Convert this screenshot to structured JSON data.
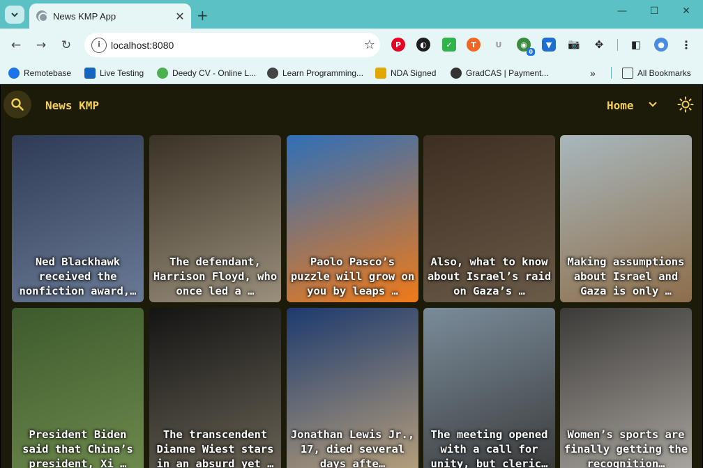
{
  "browser": {
    "tab": {
      "title": "News KMP App"
    },
    "new_tab": "+",
    "address": {
      "url": "localhost:8080"
    },
    "bookmarks": [
      {
        "label": "Remotebase",
        "icon": "remotebase-icon",
        "color": "#1a73e8"
      },
      {
        "label": "Live Testing",
        "icon": "live-testing-icon",
        "color": "#1565c0"
      },
      {
        "label": "Deedy CV - Online L...",
        "icon": "deedy-cv-icon",
        "color": "#4caf50"
      },
      {
        "label": "Learn Programming...",
        "icon": "learn-programming-icon",
        "color": "#444444"
      },
      {
        "label": "NDA Signed",
        "icon": "download-icon",
        "color": "#e0a800"
      },
      {
        "label": "GradCAS | Payment...",
        "icon": "globe-icon",
        "color": "#333333"
      }
    ],
    "all_bookmarks": "All Bookmarks",
    "extensions_badge": "0"
  },
  "app": {
    "title": "News KMP",
    "nav_menu": "Home",
    "accent_color": "#f0cf5a",
    "background_color": "#1c1a08"
  },
  "articles": [
    {
      "title": "Ned Blackhawk received the nonfiction award,…",
      "tone": [
        "#2f3b55",
        "#6a7a96"
      ]
    },
    {
      "title": "The defendant, Harrison Floyd, who once led a …",
      "tone": [
        "#3a3226",
        "#9a8f7c"
      ]
    },
    {
      "title": "Paolo Pasco’s puzzle will grow on you by leaps …",
      "tone": [
        "#2f6fb8",
        "#f07a18"
      ]
    },
    {
      "title": "Also, what to know about Israel’s raid on Gaza’s …",
      "tone": [
        "#3d2e22",
        "#6a5a48"
      ]
    },
    {
      "title": "Making assumptions about Israel and Gaza is only …",
      "tone": [
        "#a8b7bd",
        "#8e6e4a"
      ]
    },
    {
      "title": "President Biden said that China’s president, Xi …",
      "tone": [
        "#3c5a2c",
        "#6f8a4e"
      ]
    },
    {
      "title": "The transcendent Dianne Wiest stars in an absurd yet …",
      "tone": [
        "#141414",
        "#6a6456"
      ]
    },
    {
      "title": "Jonathan Lewis Jr., 17, died several days afte…",
      "tone": [
        "#1d3a6e",
        "#b8a07c"
      ]
    },
    {
      "title": "The meeting opened with a call for unity, but cleric…",
      "tone": [
        "#7a8c9a",
        "#3a3a3a"
      ]
    },
    {
      "title": "Women’s sports are finally getting the recognition…",
      "tone": [
        "#3c3a38",
        "#aaa6a0"
      ]
    }
  ]
}
